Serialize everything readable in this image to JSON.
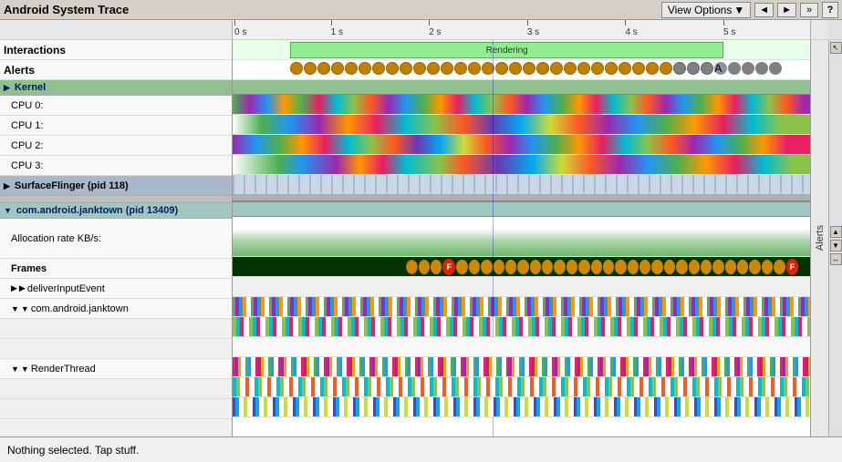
{
  "title": "Android System Trace",
  "toolbar": {
    "view_options": "View Options",
    "nav_left": "◄",
    "nav_right": "►",
    "nav_expand": "»",
    "help": "?"
  },
  "alerts_sidebar": {
    "label": "Alerts"
  },
  "timeline": {
    "ticks": [
      "0 s",
      "1 s",
      "2 s",
      "3 s",
      "4 s",
      "5 s"
    ]
  },
  "sections": {
    "interactions": "Interactions",
    "alerts": "Alerts",
    "kernel": "Kernel",
    "kernel_collapsed": true,
    "cpu0": "CPU 0:",
    "cpu1": "CPU 1:",
    "cpu2": "CPU 2:",
    "cpu3": "CPU 3:",
    "surface_flinger": "SurfaceFlinger (pid 118)",
    "com_android_janktown": "com.android.janktown (pid 13409)",
    "allocation_rate": "Allocation rate KB/s:",
    "frames": "Frames",
    "deliver_input_event": "deliverInputEvent",
    "com_android_janktown_thread": "com.android.janktown",
    "render_thread": "RenderThread"
  },
  "rendering_label": "Rendering",
  "status_bar": {
    "text": "Nothing selected. Tap stuff."
  }
}
